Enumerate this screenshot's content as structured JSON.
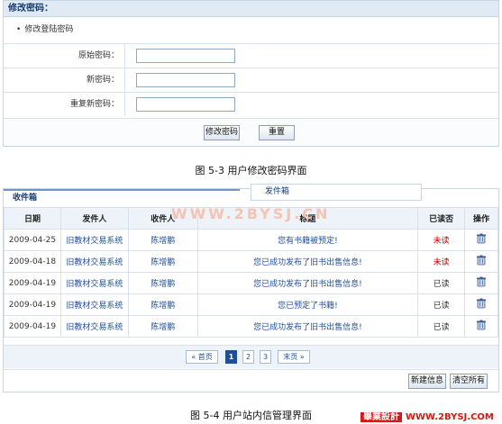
{
  "password_panel": {
    "title": "修改密码：",
    "subtitle": "修改登陆密码",
    "fields": [
      {
        "label": "原始密码：",
        "value": ""
      },
      {
        "label": "新密码：",
        "value": ""
      },
      {
        "label": "重复新密码：",
        "value": ""
      }
    ],
    "submit_label": "修改密码",
    "reset_label": "重置"
  },
  "caption_1": "图 5-3  用户修改密码界面",
  "inbox_panel": {
    "tabs": [
      {
        "label": "收件箱",
        "active": true
      },
      {
        "label": "发件箱",
        "active": false
      }
    ],
    "watermark": "WWW.2BYSJ.CN",
    "columns": [
      "日期",
      "发件人",
      "收件人",
      "标题",
      "已读否",
      "操作"
    ],
    "rows": [
      {
        "date": "2009-04-25",
        "sender": "旧教材交易系统",
        "recipient": "陈增鹏",
        "subject": "您有书籍被预定!",
        "read": "未读",
        "action_icon": "trash-icon"
      },
      {
        "date": "2009-04-18",
        "sender": "旧教材交易系统",
        "recipient": "陈增鹏",
        "subject": "您已成功发布了旧书出售信息!",
        "read": "未读",
        "action_icon": "trash-icon"
      },
      {
        "date": "2009-04-19",
        "sender": "旧教材交易系统",
        "recipient": "陈增鹏",
        "subject": "您已成功发布了旧书出售信息!",
        "read": "已读",
        "action_icon": "trash-icon"
      },
      {
        "date": "2009-04-19",
        "sender": "旧教材交易系统",
        "recipient": "陈增鹏",
        "subject": "您已预定了书籍!",
        "read": "已读",
        "action_icon": "trash-icon"
      },
      {
        "date": "2009-04-19",
        "sender": "旧教材交易系统",
        "recipient": "陈增鹏",
        "subject": "您已成功发布了旧书出售信息!",
        "read": "已读",
        "action_icon": "trash-icon"
      }
    ],
    "pager": {
      "first_label": "« 首页",
      "pages": [
        "1",
        "2",
        "3"
      ],
      "current_page": "1",
      "last_label": "末页 »"
    },
    "new_label": "新建信息",
    "clear_label": "清空所有"
  },
  "caption_2": "图 5-4  用户站内信管理界面",
  "logo": {
    "text_1": "畢業設計",
    "text_2": "WWW.2BYSJ.COM"
  },
  "colors": {
    "accent": "#1f4f9b",
    "unread": "#d00000",
    "header_bg": "#eef3f9",
    "border": "#d7e2ee"
  }
}
